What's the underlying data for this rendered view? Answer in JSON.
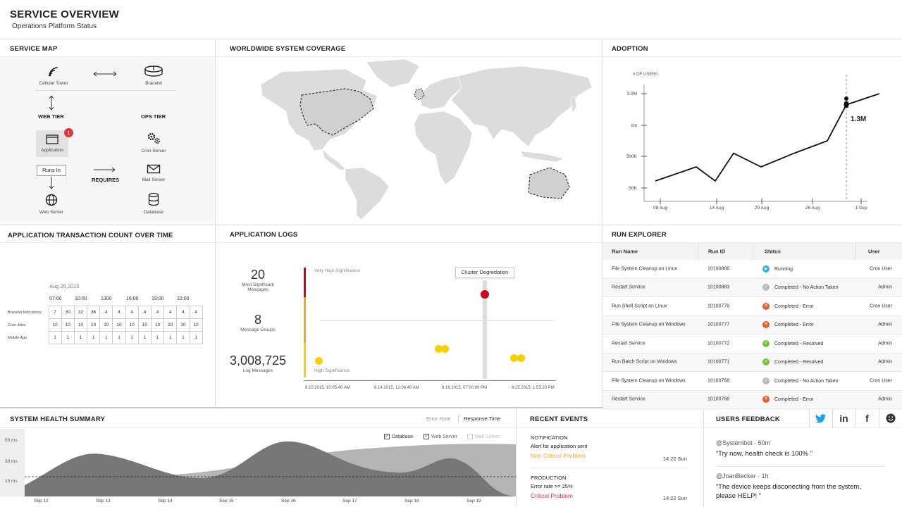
{
  "header": {
    "title": "SERVICE OVERVIEW",
    "subtitle": "Operations Platform Status"
  },
  "service_map": {
    "title": "SERVICE MAP",
    "nodes": {
      "cellular": "Cellular Tower",
      "bracelet": "Bracelet",
      "application": "Application",
      "cron": "Cron Server",
      "mail": "Mail Server",
      "web": "Web Server",
      "database": "Database"
    },
    "web_tier": "WEB TIER",
    "ops_tier": "OPS TIER",
    "runs_in": "Runs In",
    "requires": "REQUIRES",
    "badge": "1"
  },
  "coverage": {
    "title": "WORLDWIDE SYSTEM COVERAGE"
  },
  "adoption": {
    "title": "ADOPTION",
    "y_label": "# OF USERS",
    "y_ticks": [
      "3.0M",
      "1m",
      "500K",
      "50K"
    ],
    "x_ticks": [
      "08 Aug",
      "14 Aug",
      "20 Aug",
      "26 Aug",
      "1 Sep"
    ],
    "marker_label": "1.3M"
  },
  "chart_data": {
    "type": "line",
    "x": [
      0,
      1,
      2,
      3,
      4,
      5,
      6,
      7,
      8
    ],
    "values": [
      0.15,
      0.35,
      0.15,
      0.55,
      0.35,
      0.55,
      0.75,
      2.3,
      3.0
    ],
    "title": "ADOPTION",
    "ylabel": "# OF USERS",
    "annotation": "1.3M"
  },
  "transactions": {
    "title": "APPLICATION TRANSACTION COUNT OVER TIME",
    "date": "Aug 25,2015",
    "times": [
      "07:00",
      "10:00",
      "1300",
      "16:00",
      "19:00",
      "22:00"
    ],
    "rows": [
      {
        "label": "Bracelet Indications",
        "values": [
          "7",
          "30",
          "32",
          "36",
          "4",
          "4",
          "4",
          "4",
          "4",
          "4",
          "4",
          "4"
        ]
      },
      {
        "label": "Cron Jobs",
        "values": [
          "10",
          "10",
          "10",
          "10",
          "10",
          "10",
          "10",
          "10",
          "10",
          "10",
          "10",
          "10"
        ]
      },
      {
        "label": "Mobile App",
        "values": [
          "1",
          "1",
          "1",
          "1",
          "1",
          "1",
          "1",
          "1",
          "1",
          "1",
          "1",
          "1"
        ]
      }
    ]
  },
  "logs": {
    "title": "APPLICATION LOGS",
    "stat1_value": "20",
    "stat1_label1": "Most Significant",
    "stat1_label2": "Messages",
    "stat2_value": "8",
    "stat2_label": "Message Groups",
    "stat3_value": "3,008,725",
    "stat3_label": "Log Messages",
    "very_high": "Very High Significance",
    "high": "High Significance",
    "tooltip": "Cluster Degredation",
    "x_ticks": [
      "8.10.2015, 10:05:40 AM",
      "8.14.2015, 12:06:40 AM",
      "8.19.2015, 07:00:00 PM",
      "8.25.2015, 1:53:20 PM"
    ]
  },
  "run_explorer": {
    "title": "RUN EXPLORER",
    "columns": [
      "Run Name",
      "Run ID",
      "Status",
      "User"
    ],
    "rows": [
      {
        "name": "File System Cleanup on Linux",
        "id": "10100886",
        "status": "Running",
        "icon": "running",
        "user": "Cron User"
      },
      {
        "name": "Restart Service",
        "id": "10100883",
        "status": "Completed - No Action Taken",
        "icon": "none",
        "user": "Admin"
      },
      {
        "name": "Run Shell Script on Linux",
        "id": "10100778",
        "status": "Completed - Error",
        "icon": "error",
        "user": "Cron User"
      },
      {
        "name": "File System Cleanup on Windows",
        "id": "10100777",
        "status": "Completed - Error",
        "icon": "error",
        "user": "Admin"
      },
      {
        "name": "Restart Service",
        "id": "10100772",
        "status": "Completed - Resolved",
        "icon": "resolved",
        "user": "Admin"
      },
      {
        "name": "Run Batch Script on Windows",
        "id": "10100771",
        "status": "Completed - Resolved",
        "icon": "resolved",
        "user": "Admin"
      },
      {
        "name": "File System Cleanup on Windows",
        "id": "10100768",
        "status": "Completed - No Action Taken",
        "icon": "none",
        "user": "Cron User"
      },
      {
        "name": "Restart Service",
        "id": "10100768",
        "status": "Completed - Error",
        "icon": "error",
        "user": "Admin"
      }
    ]
  },
  "health": {
    "title": "SYSTEM HEALTH SUMMARY",
    "tab_error": "Error Rate",
    "tab_response": "Response Time",
    "legend": [
      "Database",
      "Web Server",
      "Mail Server"
    ],
    "y_ticks": [
      "50 ms",
      "30 ms",
      "10 ms"
    ],
    "x_ticks": [
      "Sep 12",
      "Sep 13",
      "Sep 14",
      "Sep 15",
      "Sep 16",
      "Sep 17",
      "Sep 18",
      "Sep 19"
    ]
  },
  "events": {
    "title": "RECENT EVENTS",
    "items": [
      {
        "type": "NOTIFICATION",
        "text": "Alert for application sent",
        "level": "Non Critical Problem",
        "time": "14:22 Sun",
        "color": "#f5a623"
      },
      {
        "type": "PRODUCTION",
        "text": "Error rate >= 25%",
        "level": "Critical Problem",
        "time": "14:22 Sun",
        "color": "#e0383e"
      }
    ]
  },
  "feedback": {
    "title": "USERS FEEDBACK",
    "items": [
      {
        "user": "@Systembot",
        "time": "50m",
        "text": "“Try now, health check is 100% ”"
      },
      {
        "user": "@JoanBecker",
        "time": "1h",
        "text1": "“The device keeps disconecting from the system,",
        "text2": "please HELP! ”"
      }
    ]
  },
  "colors": {
    "accent_red": "#e0383e",
    "yellow": "#f5d000",
    "orange": "#f5a623",
    "blue": "#3ab0e0",
    "green": "#7ac143"
  }
}
